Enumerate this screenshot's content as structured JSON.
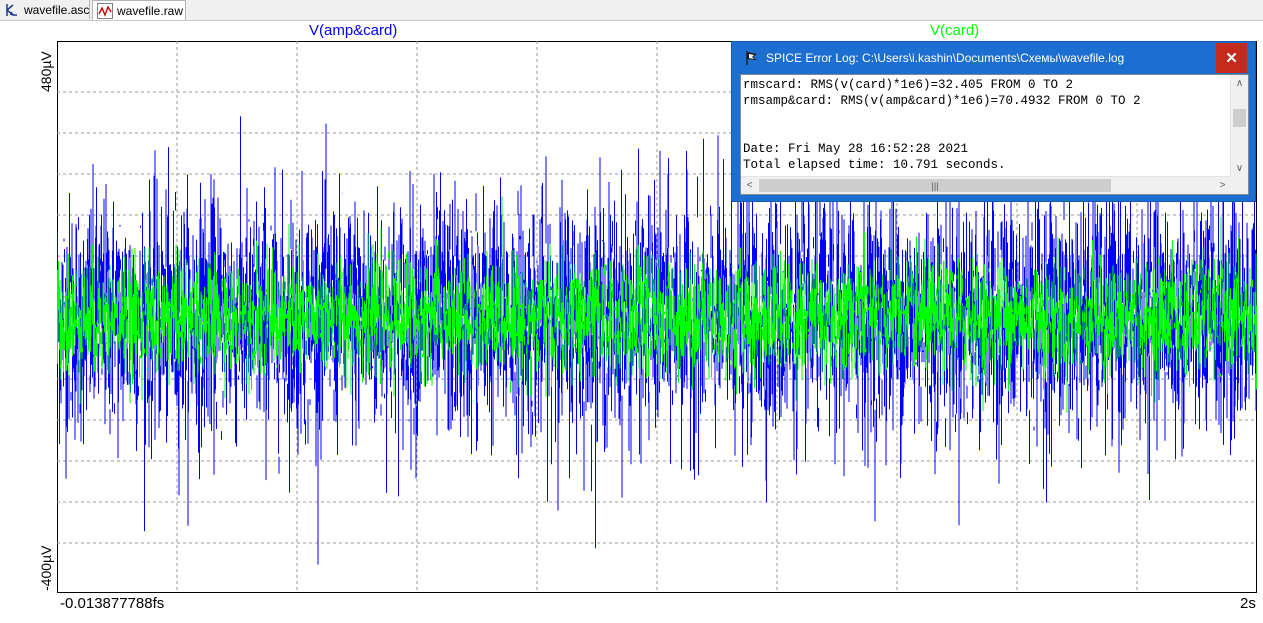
{
  "tabs": [
    {
      "label": "wavefile.asc",
      "icon": "schematic-icon",
      "active": false
    },
    {
      "label": "wavefile.raw",
      "icon": "waveform-icon",
      "active": true
    }
  ],
  "traces": [
    {
      "name": "V(amp&card)",
      "color": "#0000ff"
    },
    {
      "name": "V(card)",
      "color": "#00ff00"
    }
  ],
  "axes": {
    "y_top_label": "480µV",
    "y_bottom_label": "-400µV",
    "x_left_label": "-0.013877788fs",
    "x_right_label": "2s"
  },
  "chart_data": {
    "type": "line",
    "series": [
      {
        "name": "V(amp&card)",
        "color": "#0000ff",
        "rms": 70.4932
      },
      {
        "name": "V(card)",
        "color": "#00ff00",
        "rms": 32.405
      }
    ],
    "xlim": [
      0,
      2
    ],
    "ylim": [
      -400,
      480
    ],
    "grid": true
  },
  "log_window": {
    "title": "SPICE Error Log: C:\\Users\\i.kashin\\Documents\\Схемы\\wavefile.log",
    "close_label": "✕",
    "lines": [
      "rmscard: RMS(v(card)*1e6)=32.405 FROM 0 TO 2",
      "rmsamp&card: RMS(v(amp&card)*1e6)=70.4932 FROM 0 TO 2",
      "",
      "",
      "Date: Fri May 28 16:52:28 2021",
      "Total elapsed time: 10.791 seconds."
    ]
  }
}
